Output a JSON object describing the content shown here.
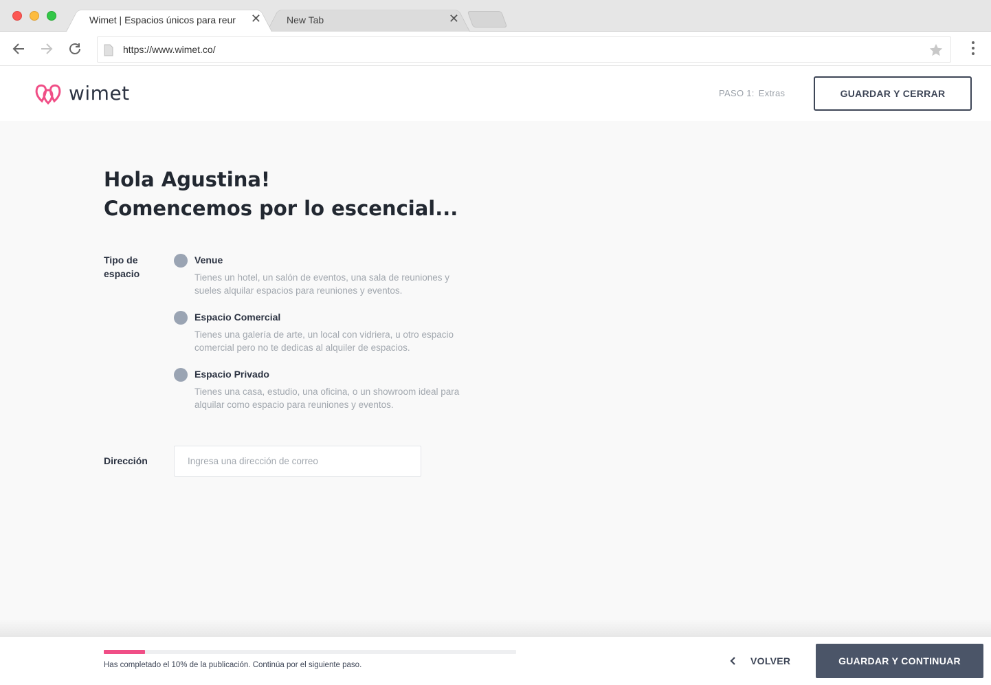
{
  "browser": {
    "tabs": [
      {
        "title": "Wimet | Espacios únicos para reur",
        "active": true
      },
      {
        "title": "New Tab",
        "active": false
      }
    ],
    "url": "https://www.wimet.co/"
  },
  "header": {
    "logo_text": "wimet",
    "step_prefix": "PASO 1:",
    "step_name": "Extras",
    "save_close_label": "GUARDAR Y CERRAR"
  },
  "main": {
    "greeting": "Hola Agustina!",
    "subtitle": "Comencemos por lo escencial...",
    "space_type_label": "Tipo de espacio",
    "options": [
      {
        "title": "Venue",
        "description": "Tienes un hotel, un salón de eventos, una sala de reuniones y sueles alquilar espacios para reuniones y eventos."
      },
      {
        "title": "Espacio Comercial",
        "description": "Tienes una galería de arte, un local con vidriera, u otro espacio comercial pero no te dedicas al alquiler de espacios."
      },
      {
        "title": "Espacio Privado",
        "description": "Tienes una casa, estudio, una oficina, o un showroom ideal para alquilar como espacio para reuniones y eventos."
      }
    ],
    "address_label": "Dirección",
    "address_placeholder": "Ingresa una dirección de correo",
    "address_value": ""
  },
  "footer": {
    "progress_percent": 10,
    "progress_text": "Has completado el 10% de la publicación. Continúa por el siguiente paso.",
    "back_label": "VOLVER",
    "continue_label": "GUARDAR Y CONTINUAR"
  },
  "colors": {
    "accent": "#f04e86",
    "dark": "#4b5568",
    "radio": "#9aa4b3"
  }
}
